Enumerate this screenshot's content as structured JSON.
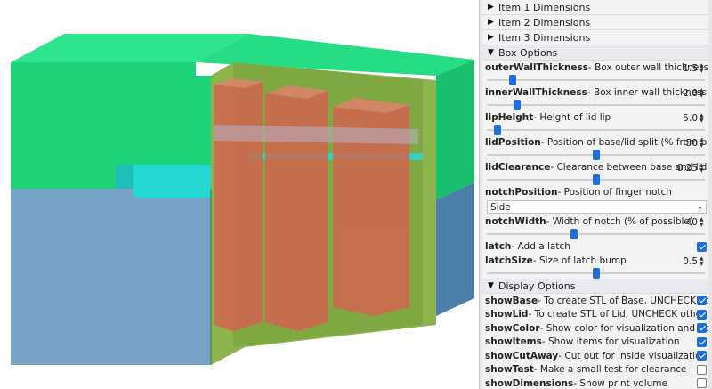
{
  "groups": {
    "item1": "Item 1 Dimensions",
    "item2": "Item 2 Dimensions",
    "item3": "Item 3 Dimensions",
    "box_options": "Box Options",
    "display_options": "Display Options"
  },
  "box_options": {
    "outer_wall": {
      "name": "outerWallThickness",
      "desc": " - Box outer wall thickness",
      "value": "1.5",
      "slider": 0.12
    },
    "inner_wall": {
      "name": "innerWallThickness",
      "desc": " - Box inner wall thickness (arou",
      "value": "2.0",
      "slider": 0.14
    },
    "lip_height": {
      "name": "lipHeight",
      "desc": " - Height of lid lip",
      "value": "5.0",
      "slider": 0.05
    },
    "lid_position": {
      "name": "lidPosition",
      "desc": " - Position of base/lid split (% from botto",
      "value": "50",
      "slider": 0.5
    },
    "lid_clearance": {
      "name": "lidClearance",
      "desc": " - Clearance between base and lid",
      "value": "0.25",
      "slider": 0.5
    },
    "notch_position": {
      "name": "notchPosition",
      "desc": " - Position of finger notch",
      "selected": "Side"
    },
    "notch_width": {
      "name": "notchWidth",
      "desc": " - Width of notch (% of possible)",
      "value": "40",
      "slider": 0.4
    },
    "latch": {
      "name": "latch",
      "desc": " - Add a latch",
      "checked": true
    },
    "latch_size": {
      "name": "latchSize",
      "desc": " - Size of latch bump",
      "value": "0.5",
      "slider": 0.5
    }
  },
  "display_options": {
    "show_base": {
      "name": "showBase",
      "desc": " - To create STL of Base, UNCHECK other optio",
      "checked": true
    },
    "show_lid": {
      "name": "showLid",
      "desc": " - To create STL of Lid, UNCHECK other options",
      "checked": true
    },
    "show_color": {
      "name": "showColor",
      "desc": " - Show color for visualization and debug",
      "checked": true
    },
    "show_items": {
      "name": "showItems",
      "desc": " - Show items for visualization",
      "checked": true
    },
    "show_cutaway": {
      "name": "showCutAway",
      "desc": " - Cut out for inside visualization",
      "checked": true
    },
    "show_test": {
      "name": "showTest",
      "desc": " - Make a small test for clearance",
      "checked": false
    },
    "show_dimensions": {
      "name": "showDimensions",
      "desc": " - Show print volume",
      "checked": false
    }
  },
  "colors": {
    "accent": "#1e6fd9",
    "lid_green": "#2fd884",
    "base_blue": "#7aa6c8",
    "inner_olive": "#8cb34a",
    "cyan": "#19d6d0",
    "item_red": "#d06a55"
  },
  "icons": {
    "collapsed": "triangle-right-icon",
    "expanded": "triangle-down-icon"
  }
}
